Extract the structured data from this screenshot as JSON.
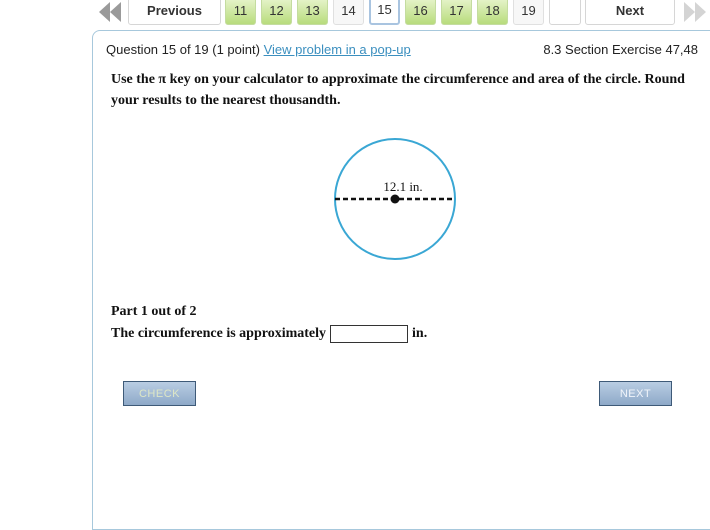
{
  "nav": {
    "previous_label": "Previous",
    "next_label": "Next",
    "questions": [
      {
        "number": "11",
        "status": "done"
      },
      {
        "number": "12",
        "status": "done"
      },
      {
        "number": "13",
        "status": "done"
      },
      {
        "number": "14",
        "status": "plain"
      },
      {
        "number": "15",
        "status": "current"
      },
      {
        "number": "16",
        "status": "done"
      },
      {
        "number": "17",
        "status": "done"
      },
      {
        "number": "18",
        "status": "done"
      },
      {
        "number": "19",
        "status": "plain"
      }
    ]
  },
  "question": {
    "header": "Question 15 of 19 (1 point)",
    "popup_link": "View problem in a pop-up",
    "section": "8.3 Section Exercise 47,48",
    "instruction": "Use the π key on your calculator to approximate the circumference and area of the circle. Round your results to the nearest thousandth.",
    "figure": {
      "diameter_label": "12.1 in.",
      "circle_color": "#3aa7d4"
    },
    "part": "Part 1 out of 2",
    "prompt": "The circumference is approximately",
    "answer_value": "",
    "unit": "in."
  },
  "buttons": {
    "check_label": "CHECK",
    "next_label": "NEXT"
  }
}
